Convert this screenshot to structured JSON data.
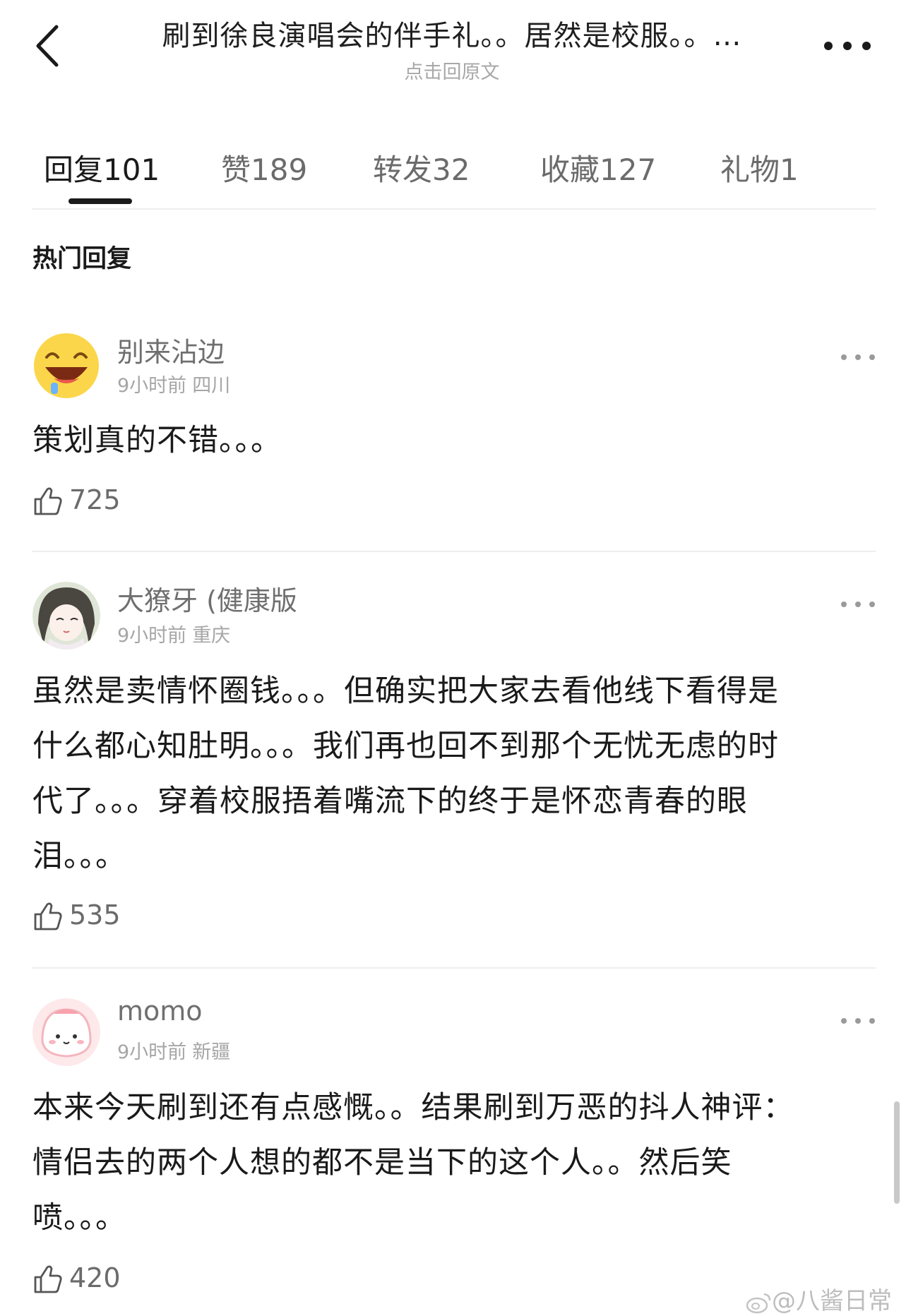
{
  "header": {
    "title": "刷到徐良演唱会的伴手礼。。居然是校服。。…",
    "subtitle": "点击回原文"
  },
  "tabs": [
    {
      "label": "回复101"
    },
    {
      "label": "赞189"
    },
    {
      "label": "转发32"
    },
    {
      "label": "收藏127"
    },
    {
      "label": "礼物1"
    }
  ],
  "section_title": "热门回复",
  "comments": [
    {
      "user": "别来沾边",
      "time": "9小时前",
      "location": "四川",
      "lines": [
        "策划真的不错。。。"
      ],
      "likes": "725"
    },
    {
      "user": "大獠牙 (健康版",
      "time": "9小时前",
      "location": "重庆",
      "lines": [
        "虽然是卖情怀圈钱。。。但确实把大家去看他线下看得是",
        "什么都心知肚明。。。我们再也回不到那个无忧无虑的时",
        "代了。。。穿着校服捂着嘴流下的终于是怀恋青春的眼",
        "泪。。。"
      ],
      "likes": "535"
    },
    {
      "user": "momo",
      "time": "9小时前",
      "location": "新疆",
      "lines": [
        "本来今天刷到还有点感慨。。结果刷到万恶的抖人神评：",
        "情侣去的两个人想的都不是当下的这个人。。然后笑",
        "喷。。。"
      ],
      "likes": "420"
    }
  ],
  "watermark": "@八酱日常",
  "icons": {
    "back": "chevron-left-icon",
    "more": "more-dots-icon",
    "like": "thumbs-up-icon",
    "watermark": "weibo-icon"
  }
}
